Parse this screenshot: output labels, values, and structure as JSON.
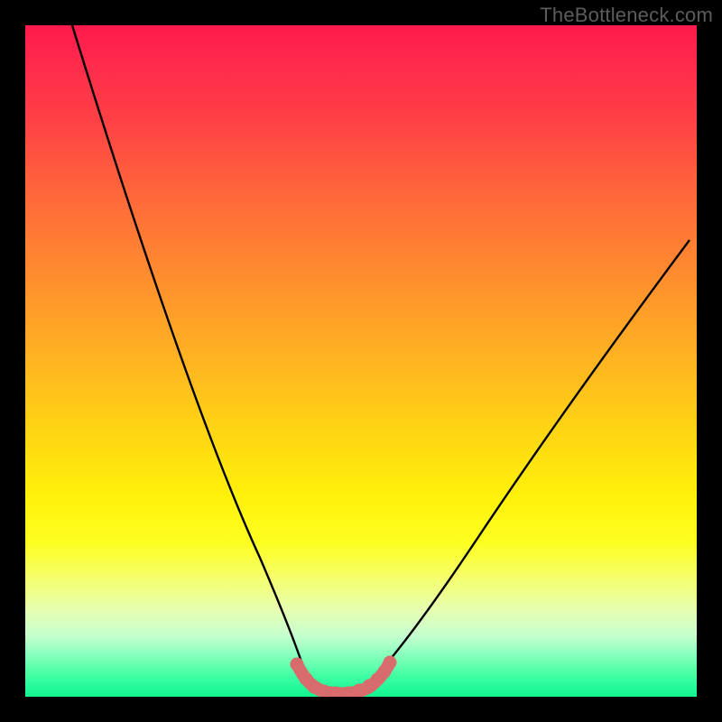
{
  "watermark": "TheBottleneck.com",
  "chart_data": {
    "type": "line",
    "title": "",
    "xlabel": "",
    "ylabel": "",
    "xlim": [
      0,
      100
    ],
    "ylim": [
      0,
      100
    ],
    "curve_left": {
      "name": "left-branch",
      "x": [
        7,
        12,
        18,
        24,
        30,
        34,
        37,
        39,
        41,
        42.5
      ],
      "y": [
        100,
        82,
        64,
        46,
        28,
        16,
        8,
        4,
        1.5,
        0.5
      ]
    },
    "curve_right": {
      "name": "right-branch",
      "x": [
        50.5,
        53,
        56,
        62,
        70,
        80,
        90,
        99
      ],
      "y": [
        0.5,
        2,
        5,
        12,
        24,
        40,
        55,
        68
      ]
    },
    "flat_segment": {
      "x": [
        42.5,
        50.5
      ],
      "y": [
        0.5,
        0.5
      ]
    },
    "markers": {
      "name": "highlight-dots",
      "color": "#d86b6b",
      "points": [
        {
          "x": 40.5,
          "y": 4.2
        },
        {
          "x": 41.8,
          "y": 2.2
        },
        {
          "x": 42.7,
          "y": 1.0
        },
        {
          "x": 44.2,
          "y": 0.6
        },
        {
          "x": 46.0,
          "y": 0.5
        },
        {
          "x": 48.0,
          "y": 0.5
        },
        {
          "x": 49.8,
          "y": 0.7
        },
        {
          "x": 51.2,
          "y": 1.2
        },
        {
          "x": 52.4,
          "y": 2.0
        },
        {
          "x": 53.4,
          "y": 3.0
        },
        {
          "x": 54.3,
          "y": 4.0
        }
      ]
    }
  }
}
